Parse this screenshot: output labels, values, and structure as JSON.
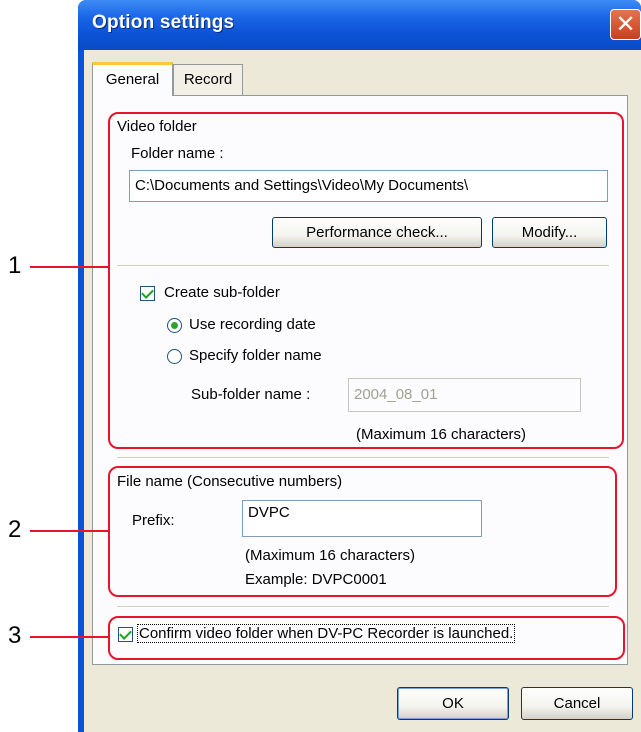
{
  "window": {
    "title": "Option settings",
    "close_glyph": "✕"
  },
  "tabs": [
    {
      "label": "General"
    },
    {
      "label": "Record"
    }
  ],
  "video_folder": {
    "group_label": "Video folder",
    "folder_name_label": "Folder name :",
    "folder_path": "C:\\Documents and Settings\\Video\\My Documents\\",
    "performance_check_button": "Performance check...",
    "modify_button": "Modify...",
    "create_subfolder_label": "Create sub-folder",
    "create_subfolder_checked": true,
    "use_recording_date_label": "Use recording date",
    "use_recording_date_selected": true,
    "specify_folder_name_label": "Specify folder name",
    "subfolder_name_label": "Sub-folder name :",
    "subfolder_name_value": "2004_08_01",
    "max_chars_note": "(Maximum 16 characters)"
  },
  "file_name": {
    "group_label": "File name (Consecutive numbers)",
    "prefix_label": "Prefix:",
    "prefix_value": "DVPC",
    "max_chars_note": "(Maximum 16 characters)",
    "example": "Example: DVPC0001"
  },
  "confirm": {
    "label": "Confirm video folder when DV-PC Recorder is launched.",
    "checked": true
  },
  "footer": {
    "ok_button": "OK",
    "cancel_button": "Cancel"
  },
  "callouts": [
    {
      "number": "1"
    },
    {
      "number": "2"
    },
    {
      "number": "3"
    }
  ],
  "colors": {
    "callout": "#e8142b",
    "titlebar": "#0a52d8",
    "dialog_bg": "#ece9d8",
    "checkmark": "#21a121"
  }
}
